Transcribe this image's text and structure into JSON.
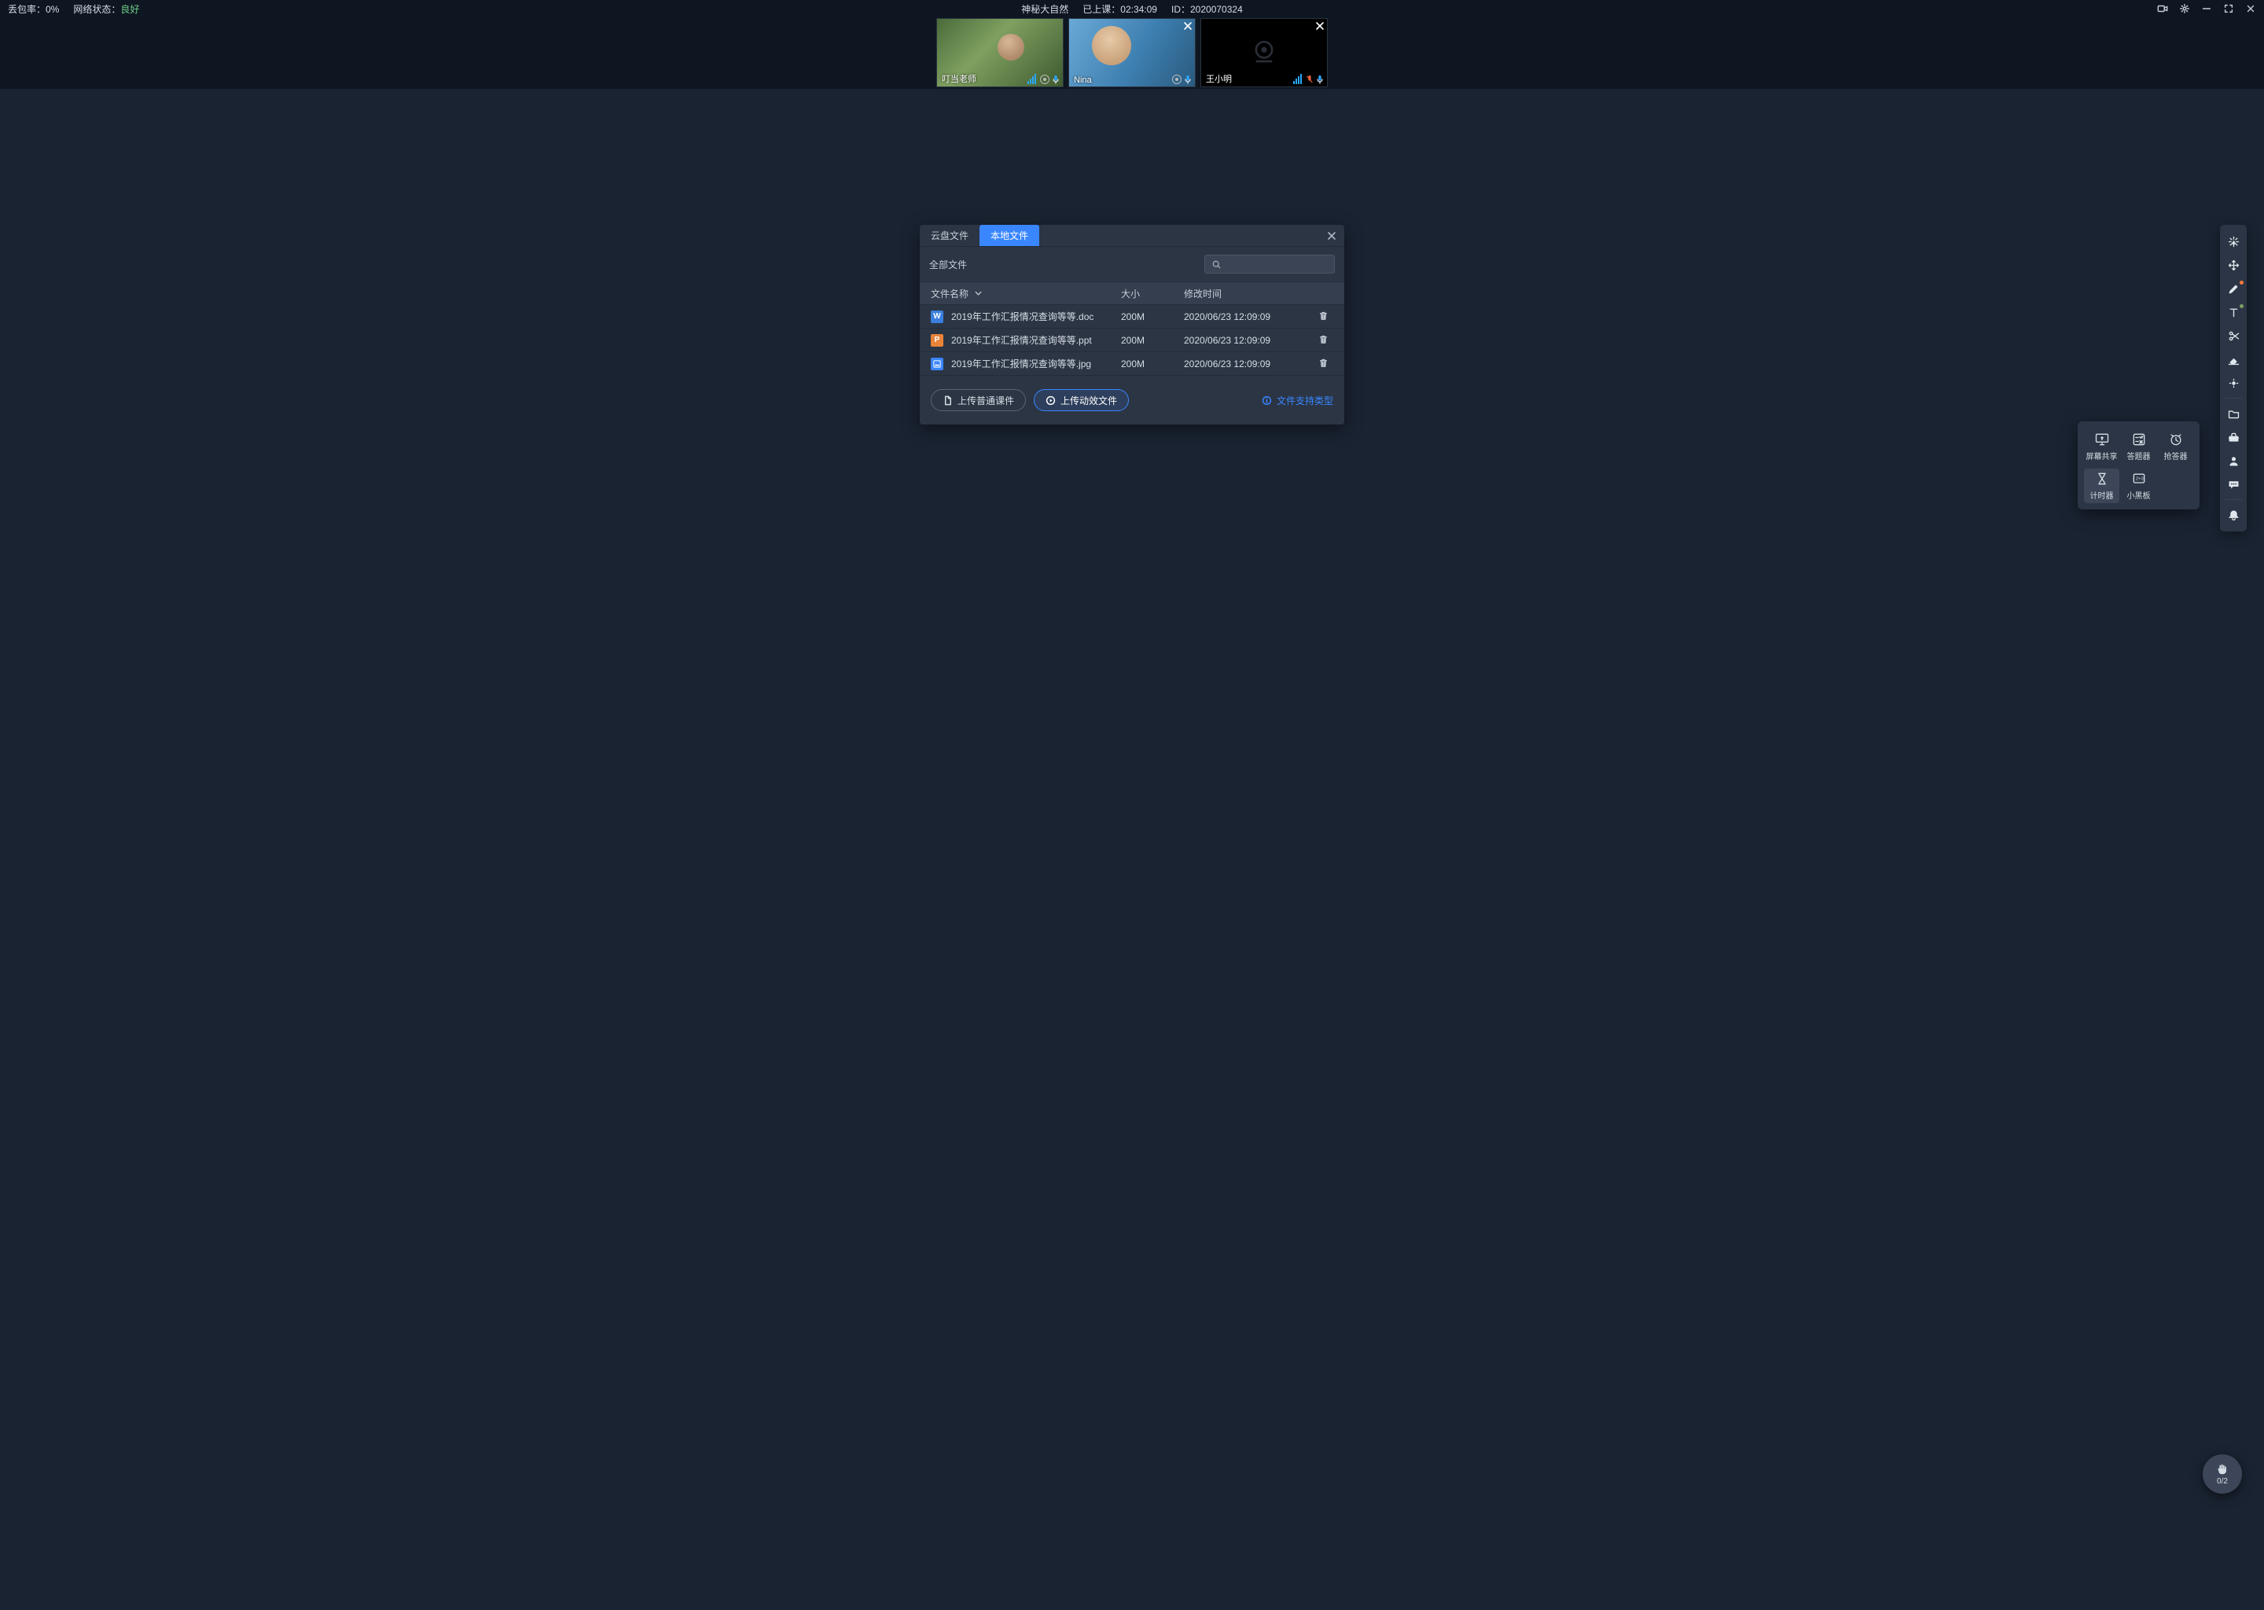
{
  "topbar": {
    "packet_loss_label": "丢包率：0%",
    "network_label": "网络状态：",
    "network_value": "良好",
    "class_title": "神秘大自然",
    "elapsed_label": "已上课：",
    "elapsed_value": "02:34:09",
    "id_label": "ID：",
    "id_value": "2020070324"
  },
  "participants": [
    {
      "name": "叮当老师",
      "camera_off": false,
      "mic_muted": false,
      "closable": false,
      "show_vol": true
    },
    {
      "name": "Nina",
      "camera_off": false,
      "mic_muted": false,
      "closable": true,
      "show_vol": false
    },
    {
      "name": "王小明",
      "camera_off": true,
      "mic_muted": true,
      "closable": true,
      "show_vol": true
    }
  ],
  "file_dialog": {
    "tabs": {
      "cloud": "云盘文件",
      "local": "本地文件",
      "active": "local"
    },
    "toolbar_label": "全部文件",
    "columns": {
      "name": "文件名称",
      "size": "大小",
      "time": "修改时间"
    },
    "files": [
      {
        "type": "doc",
        "badge": "W",
        "name": "2019年工作汇报情况查询等等.doc",
        "size": "200M",
        "time": "2020/06/23 12:09:09"
      },
      {
        "type": "ppt",
        "badge": "P",
        "name": "2019年工作汇报情况查询等等.ppt",
        "size": "200M",
        "time": "2020/06/23 12:09:09"
      },
      {
        "type": "jpg",
        "badge": "▣",
        "name": "2019年工作汇报情况查询等等.jpg",
        "size": "200M",
        "time": "2020/06/23 12:09:09"
      }
    ],
    "btn_upload_normal": "上传普通课件",
    "btn_upload_anim": "上传动效文件",
    "help_text": "文件支持类型"
  },
  "popover": {
    "items": [
      {
        "key": "screen-share",
        "label": "屏幕共享"
      },
      {
        "key": "answer",
        "label": "答题器"
      },
      {
        "key": "race",
        "label": "抢答器"
      },
      {
        "key": "timer",
        "label": "计时器",
        "active": true
      },
      {
        "key": "board",
        "label": "小黑板"
      }
    ]
  },
  "right_toolbar": {
    "items": [
      "laser-pointer",
      "move",
      "pen",
      "text",
      "scissors",
      "eraser",
      "brightness",
      "SEP",
      "folder",
      "toolbox",
      "person",
      "chat",
      "SEP",
      "bell"
    ],
    "pen_has_dot": true,
    "text_has_dot": true
  },
  "raise_hand": {
    "count_label": "0/2"
  }
}
